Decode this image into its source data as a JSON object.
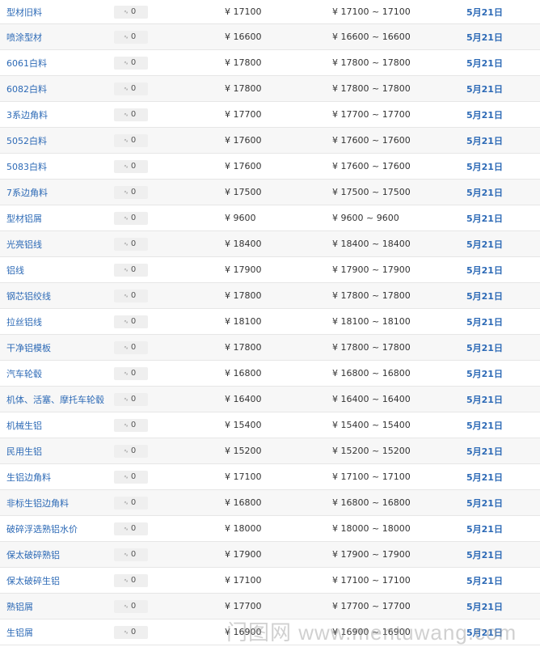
{
  "rows": [
    {
      "name": "型材旧料",
      "change": "0",
      "price": "¥ 17100",
      "range": "¥ 17100 ~ 17100",
      "date": "5月21日"
    },
    {
      "name": "喷涂型材",
      "change": "0",
      "price": "¥ 16600",
      "range": "¥ 16600 ~ 16600",
      "date": "5月21日"
    },
    {
      "name": "6061白料",
      "change": "0",
      "price": "¥ 17800",
      "range": "¥ 17800 ~ 17800",
      "date": "5月21日"
    },
    {
      "name": "6082白料",
      "change": "0",
      "price": "¥ 17800",
      "range": "¥ 17800 ~ 17800",
      "date": "5月21日"
    },
    {
      "name": "3系边角料",
      "change": "0",
      "price": "¥ 17700",
      "range": "¥ 17700 ~ 17700",
      "date": "5月21日"
    },
    {
      "name": "5052白料",
      "change": "0",
      "price": "¥ 17600",
      "range": "¥ 17600 ~ 17600",
      "date": "5月21日"
    },
    {
      "name": "5083白料",
      "change": "0",
      "price": "¥ 17600",
      "range": "¥ 17600 ~ 17600",
      "date": "5月21日"
    },
    {
      "name": "7系边角料",
      "change": "0",
      "price": "¥ 17500",
      "range": "¥ 17500 ~ 17500",
      "date": "5月21日"
    },
    {
      "name": "型材铝屑",
      "change": "0",
      "price": "¥ 9600",
      "range": "¥ 9600 ~ 9600",
      "date": "5月21日"
    },
    {
      "name": "光亮铝线",
      "change": "0",
      "price": "¥ 18400",
      "range": "¥ 18400 ~ 18400",
      "date": "5月21日"
    },
    {
      "name": "铝线",
      "change": "0",
      "price": "¥ 17900",
      "range": "¥ 17900 ~ 17900",
      "date": "5月21日"
    },
    {
      "name": "钢芯铝绞线",
      "change": "0",
      "price": "¥ 17800",
      "range": "¥ 17800 ~ 17800",
      "date": "5月21日"
    },
    {
      "name": "拉丝铝线",
      "change": "0",
      "price": "¥ 18100",
      "range": "¥ 18100 ~ 18100",
      "date": "5月21日"
    },
    {
      "name": "干净铝模板",
      "change": "0",
      "price": "¥ 17800",
      "range": "¥ 17800 ~ 17800",
      "date": "5月21日"
    },
    {
      "name": "汽车轮毂",
      "change": "0",
      "price": "¥ 16800",
      "range": "¥ 16800 ~ 16800",
      "date": "5月21日"
    },
    {
      "name": "机体、活塞、摩托车轮毂",
      "change": "0",
      "price": "¥ 16400",
      "range": "¥ 16400 ~ 16400",
      "date": "5月21日"
    },
    {
      "name": "机械生铝",
      "change": "0",
      "price": "¥ 15400",
      "range": "¥ 15400 ~ 15400",
      "date": "5月21日"
    },
    {
      "name": "民用生铝",
      "change": "0",
      "price": "¥ 15200",
      "range": "¥ 15200 ~ 15200",
      "date": "5月21日"
    },
    {
      "name": "生铝边角料",
      "change": "0",
      "price": "¥ 17100",
      "range": "¥ 17100 ~ 17100",
      "date": "5月21日"
    },
    {
      "name": "非标生铝边角料",
      "change": "0",
      "price": "¥ 16800",
      "range": "¥ 16800 ~ 16800",
      "date": "5月21日"
    },
    {
      "name": "破碎浮选熟铝水价",
      "change": "0",
      "price": "¥ 18000",
      "range": "¥ 18000 ~ 18000",
      "date": "5月21日"
    },
    {
      "name": "保太破碎熟铝",
      "change": "0",
      "price": "¥ 17900",
      "range": "¥ 17900 ~ 17900",
      "date": "5月21日"
    },
    {
      "name": "保太破碎生铝",
      "change": "0",
      "price": "¥ 17100",
      "range": "¥ 17100 ~ 17100",
      "date": "5月21日"
    },
    {
      "name": "熟铝屑",
      "change": "0",
      "price": "¥ 17700",
      "range": "¥ 17700 ~ 17700",
      "date": "5月21日"
    },
    {
      "name": "生铝屑",
      "change": "0",
      "price": "¥ 16900",
      "range": "¥ 16900 ~ 16900",
      "date": "5月21日"
    }
  ],
  "change_icon": "trend-wave-icon",
  "watermark": "门图网 www.mentuwang.com",
  "colors": {
    "link": "#2d6ab6",
    "row_alt": "#f7f7f7",
    "border": "#e6e6e6"
  }
}
